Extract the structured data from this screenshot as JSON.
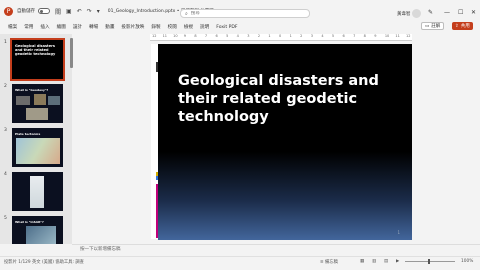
{
  "titlebar": {
    "app_logo": "P",
    "autosave_label": "自動儲存",
    "toggle_state": "關",
    "doc_name": "01_Geology_Introduction.pptx • 已儲存到 此電腦",
    "search_placeholder": "搜尋",
    "user_name": "黃韋智",
    "pen_icon": "✎",
    "minimize": "—",
    "maximize": "☐",
    "close": "✕"
  },
  "ribbon": {
    "tabs": [
      "檔案",
      "常用",
      "插入",
      "繪圖",
      "設計",
      "轉場",
      "動畫",
      "投影片放映",
      "錄製",
      "校閱",
      "檢視",
      "說明",
      "Foxit PDF"
    ],
    "comment_label": "註解",
    "share_label": "共用"
  },
  "thumbnails": [
    {
      "num": "1",
      "title": "Geological disasters and their related geodetic technology"
    },
    {
      "num": "2",
      "title": "What is \"Geodesy\"?"
    },
    {
      "num": "3",
      "title": "Plate tectonics"
    },
    {
      "num": "4",
      "title": ""
    },
    {
      "num": "5",
      "title": "What is \"InSAR\"?"
    }
  ],
  "ruler_ticks": [
    "12",
    "11",
    "10",
    "9",
    "8",
    "7",
    "6",
    "5",
    "4",
    "3",
    "2",
    "1",
    "0",
    "1",
    "2",
    "3",
    "4",
    "5",
    "6",
    "7",
    "8",
    "9",
    "10",
    "11",
    "12"
  ],
  "slide": {
    "title": "Geological disasters and their related geodetic technology",
    "number": "1"
  },
  "notes_placeholder": "按一下以新增備忘稿",
  "status": {
    "left": "投影片 1/129   英文 (美國)   協助工具: 調查",
    "notes_label": "備忘稿",
    "zoom": "100%"
  },
  "colors": {
    "accent": "#c43e1c"
  }
}
